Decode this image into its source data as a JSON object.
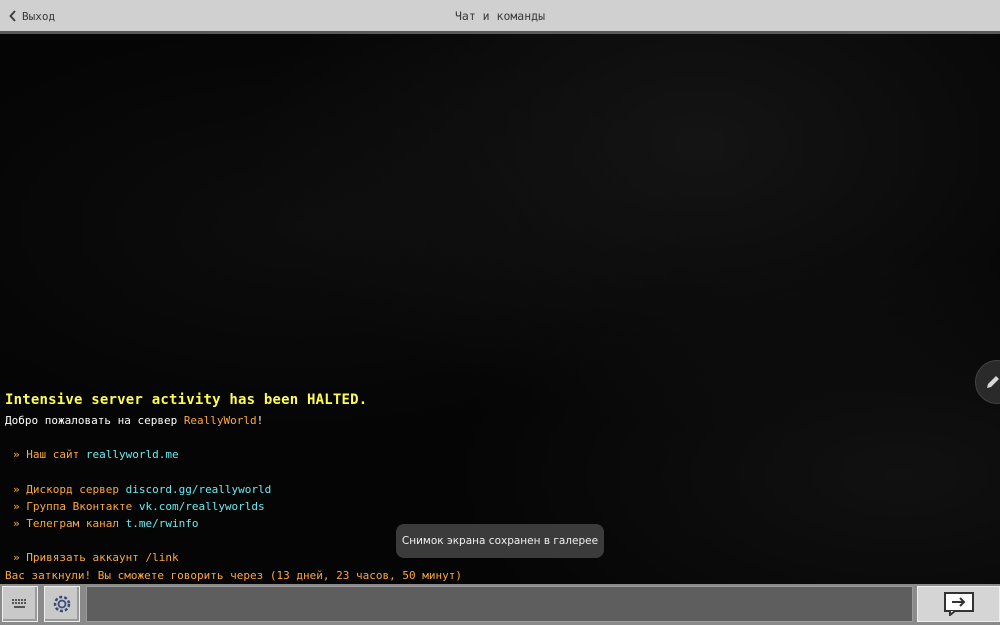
{
  "header": {
    "back_label": "Выход",
    "title": "Чат и команды"
  },
  "chat": {
    "halted": "Intensive server activity has been HALTED.",
    "welcome_prefix": "Добро пожаловать на сервер ",
    "welcome_server": "ReallyWorld",
    "welcome_suffix": "!",
    "bullet": "»",
    "site_label": "Наш сайт ",
    "site_link": "reallyworld.me",
    "discord_label": "Дискорд сервер ",
    "discord_link": "discord.gg/reallyworld",
    "vk_label": "Группа Вконтакте ",
    "vk_link": "vk.com/reallyworlds",
    "tg_label": "Телеграм канал ",
    "tg_link": "t.me/rwinfo",
    "link_cmd": "Привязать аккаунт /link",
    "muted": "Вас заткнули! Вы сможете говорить через (13 дней, 23 часов, 50 минут)"
  },
  "toast": {
    "text": "Снимок экрана сохранен в галерее"
  },
  "input": {
    "value": "",
    "placeholder": ""
  },
  "icons": {
    "back": "chevron-left-icon",
    "edit": "pencil-icon",
    "keyboard": "keyboard-icon",
    "emote": "gear-icon",
    "send": "send-arrow-icon"
  },
  "colors": {
    "halted": "#fcfc54",
    "gold": "#fca83c",
    "aqua": "#6ee8ee",
    "white": "#ffffff"
  }
}
